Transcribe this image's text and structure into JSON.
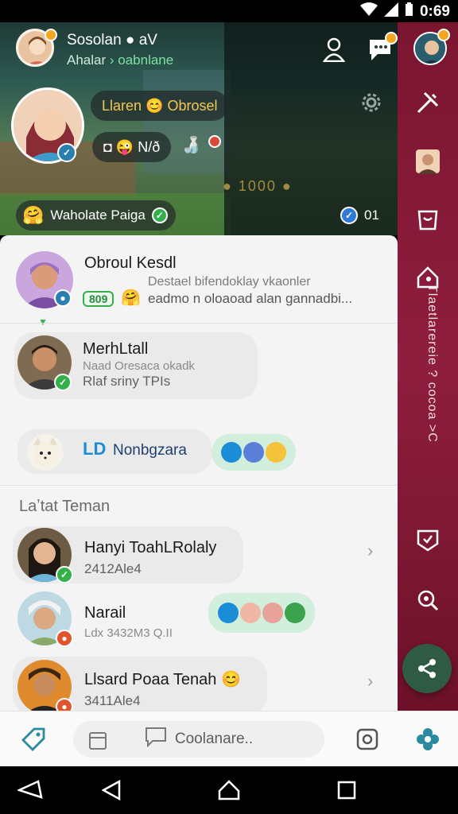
{
  "status_bar": {
    "time": "0:69"
  },
  "header": {
    "title": "Sosolan ● aV",
    "subtitle_prefix": "Ahalar",
    "subtitle_link": "› oabnlane"
  },
  "profile": {
    "greeting_chip": "Llaren 😊 Obrosel",
    "reaction_chip": "◘ 😜 N/ð",
    "blurred_text": "● 1000 ●",
    "status_label": "Waholate Paiga",
    "count": "01"
  },
  "colors": {
    "accent": "#2f5b45",
    "rail": "#7a1530",
    "online": "#34b04a",
    "link": "#1a8dd6"
  },
  "chats": [
    {
      "name": "Obroul Kesdl",
      "line1": "Destael bifendoklay vkaonler",
      "line2": "eadmo n oloaoad alan gannadbi...",
      "tag": "809",
      "tag_emoji": "🤗"
    },
    {
      "name": "MerhLtall",
      "line1": "Naad Oresaca okadk",
      "line2": "Rlaf sriny TPIs"
    },
    {
      "link_label": "Nonbgzara",
      "link_icon": "L⁠D"
    }
  ],
  "section_title": "Laʼtat Teman",
  "friends": [
    {
      "name": "Hanyi ToahLRolaly",
      "sub": "2412Ale4"
    },
    {
      "name": "Narail",
      "sub": "Ldx 3432M3 Q.II"
    },
    {
      "name": "Llsard Poaa Tenah 😊",
      "sub": "3411Ale4"
    }
  ],
  "bottom_bar": {
    "search_placeholder": "Coolanare.."
  },
  "rail": {
    "vertical_text": "Tlaetlarereie ? cocoa >C"
  }
}
